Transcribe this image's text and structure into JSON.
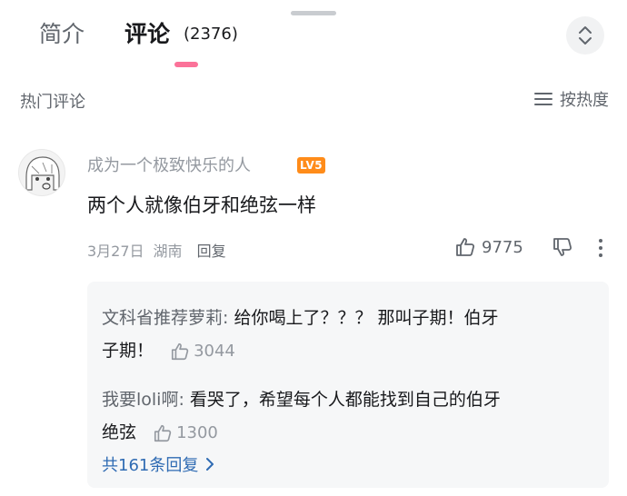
{
  "tabs": {
    "intro_label": "简介",
    "comments_label": "评论",
    "comments_count": "(2376)"
  },
  "section": {
    "title": "热门评论",
    "sort_label": "按热度"
  },
  "comment": {
    "username": "成为一个极致快乐的人",
    "level": "LV5",
    "text": "两个人就像伯牙和绝弦一样",
    "date": "3月27日",
    "location": "湖南",
    "reply_label": "回复",
    "likes": "9775"
  },
  "replies": [
    {
      "user": "文科省推荐萝莉:",
      "text": " 给你喝上了？？？ 那叫子期！伯牙",
      "text2": "子期！",
      "likes": "3044"
    },
    {
      "user": "我要loli啊:",
      "text": " 看哭了，希望每个人都能找到自己的伯牙",
      "text2": "绝弦",
      "likes": "1300"
    }
  ],
  "view_all": "共161条回复",
  "colors": {
    "accent_pink": "#fb7299",
    "link_blue": "#2f6bb3",
    "level_orange": "#ff8c1a"
  },
  "icons": [
    "chevron-up-down-icon",
    "sort-lines-icon",
    "thumb-up-icon",
    "thumb-down-icon",
    "more-vertical-icon",
    "chevron-right-icon"
  ]
}
